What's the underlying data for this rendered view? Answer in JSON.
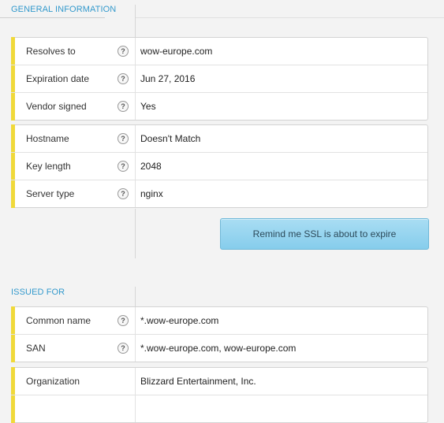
{
  "general": {
    "title": "GENERAL INFORMATION",
    "groups": [
      [
        {
          "label": "Resolves to",
          "value": "wow-europe.com",
          "help": "?"
        },
        {
          "label": "Expiration date",
          "value": "Jun 27, 2016",
          "help": "?"
        },
        {
          "label": "Vendor signed",
          "value": "Yes",
          "help": "?"
        }
      ],
      [
        {
          "label": "Hostname",
          "value": "Doesn't Match",
          "help": "?"
        },
        {
          "label": "Key length",
          "value": "2048",
          "help": "?"
        },
        {
          "label": "Server type",
          "value": "nginx",
          "help": "?"
        }
      ]
    ],
    "remind_button": "Remind me SSL is about to expire"
  },
  "issued_for": {
    "title": "ISSUED FOR",
    "groups": [
      [
        {
          "label": "Common name",
          "value": "*.wow-europe.com",
          "help": "?"
        },
        {
          "label": "SAN",
          "value": "*.wow-europe.com, wow-europe.com",
          "help": "?"
        }
      ],
      [
        {
          "label": "Organization",
          "value": "Blizzard Entertainment, Inc."
        },
        {
          "label": "",
          "value": ""
        }
      ]
    ]
  },
  "colors": {
    "accent": "#f0d93a",
    "title": "#3399cc",
    "button": "#8fd1ee"
  }
}
